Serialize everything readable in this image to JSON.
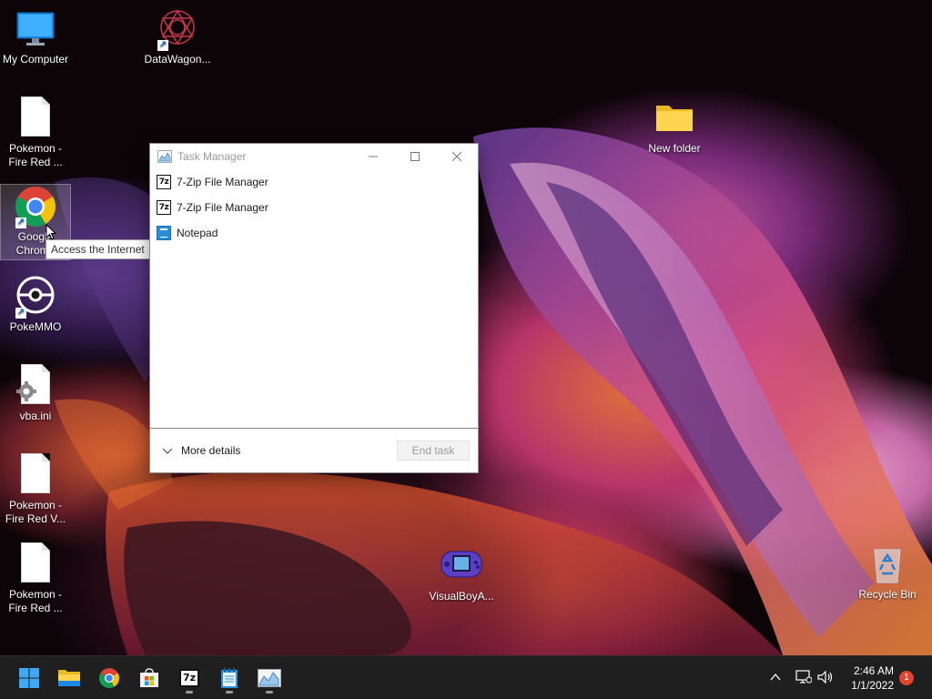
{
  "desktop": {
    "icons": [
      {
        "id": "my-computer",
        "label": "My Computer",
        "icon": "monitor-icon",
        "shortcut": false
      },
      {
        "id": "datawagon",
        "label": "DataWagon...",
        "icon": "datawagon-mandala-icon",
        "shortcut": true
      },
      {
        "id": "pokemon-fire-red-1",
        "label": "Pokemon - Fire Red ...",
        "icon": "blank-document-icon",
        "shortcut": false
      },
      {
        "id": "google-chrome",
        "label": "Google Chrome",
        "icon": "chrome-icon",
        "shortcut": true
      },
      {
        "id": "pokemmo",
        "label": "PokeMMO",
        "icon": "pokeball-icon",
        "shortcut": true
      },
      {
        "id": "vba-ini",
        "label": "vba.ini",
        "icon": "settings-file-icon",
        "shortcut": false
      },
      {
        "id": "pokemon-fire-red-v",
        "label": "Pokemon - Fire Red V...",
        "icon": "blank-document-icon",
        "shortcut": false
      },
      {
        "id": "pokemon-fire-red-2",
        "label": "Pokemon - Fire Red ...",
        "icon": "blank-document-icon",
        "shortcut": false
      },
      {
        "id": "new-folder",
        "label": "New folder",
        "icon": "folder-icon",
        "shortcut": false
      },
      {
        "id": "visualboy",
        "label": "VisualBoyA...",
        "icon": "gameboy-advance-icon",
        "shortcut": false
      },
      {
        "id": "recycle-bin",
        "label": "Recycle Bin",
        "icon": "recycle-bin-icon",
        "shortcut": false
      }
    ],
    "tooltip": "Access the Internet"
  },
  "task_manager": {
    "title": "Task Manager",
    "controls": {
      "minimize": "minimize-icon",
      "maximize": "maximize-icon",
      "close": "close-icon"
    },
    "apps": [
      {
        "name": "7-Zip File Manager",
        "icon": "7zip-icon",
        "icon_text": "7z"
      },
      {
        "name": "7-Zip File Manager",
        "icon": "7zip-icon",
        "icon_text": "7z"
      },
      {
        "name": "Notepad",
        "icon": "notepad-icon",
        "icon_text": ""
      }
    ],
    "more_details": "More details",
    "end_task": "End task"
  },
  "taskbar": {
    "pinned": [
      {
        "name": "start",
        "icon": "windows-start-icon",
        "running": false
      },
      {
        "name": "file-explorer",
        "icon": "folder-icon",
        "running": false
      },
      {
        "name": "chrome",
        "icon": "chrome-icon",
        "running": false
      },
      {
        "name": "microsoft-store",
        "icon": "store-bag-icon",
        "running": false
      },
      {
        "name": "7-zip",
        "icon": "7zip-icon",
        "icon_text": "7z",
        "running": true
      },
      {
        "name": "notepad",
        "icon": "notepad-icon",
        "running": true
      },
      {
        "name": "task-manager",
        "icon": "task-manager-icon",
        "running": true
      }
    ],
    "tray": {
      "icons": [
        "chevron-up-icon",
        "network-icon",
        "volume-icon"
      ],
      "time": "2:46 AM",
      "date": "1/1/2022",
      "notification_count": "1"
    }
  },
  "colors": {
    "taskbar_bg": "#1f1f1f",
    "window_bg": "#ffffff",
    "badge": "#e0462f",
    "accent_blue": "#1e88e5"
  }
}
